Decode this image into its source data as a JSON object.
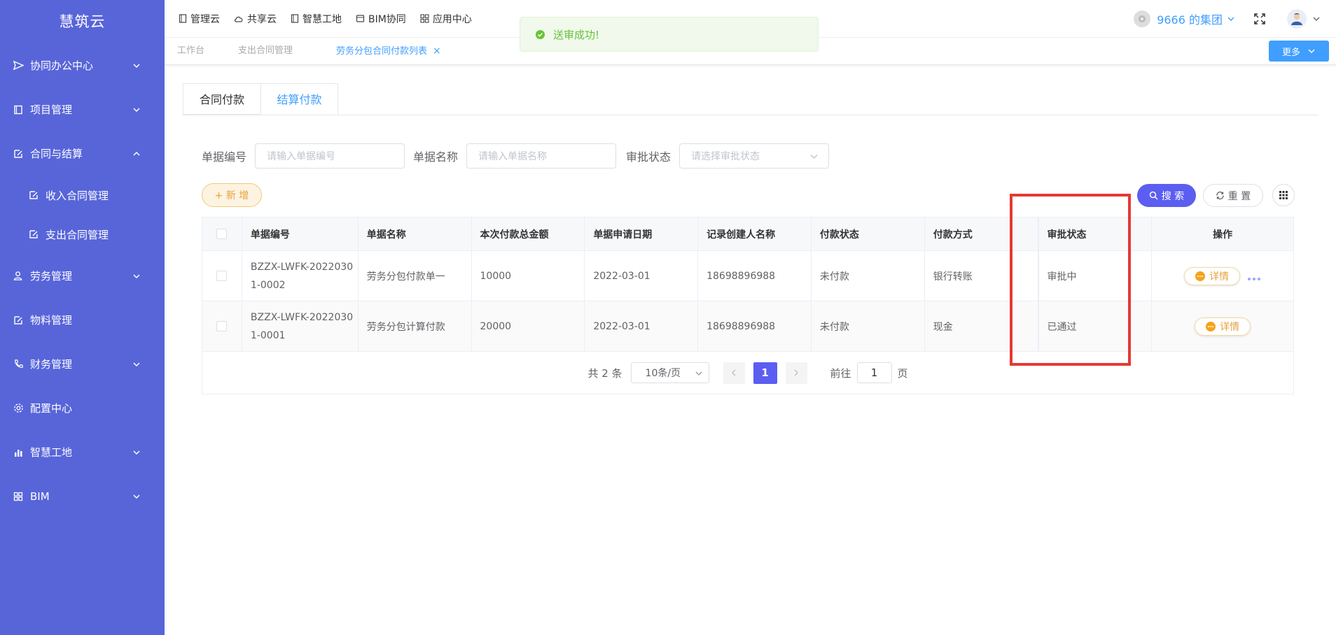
{
  "brand": "慧筑云",
  "sidebar": {
    "items": [
      {
        "label": "协同办公中心",
        "icon": "send-icon"
      },
      {
        "label": "项目管理",
        "icon": "book-icon"
      },
      {
        "label": "合同与结算",
        "icon": "edit-doc-icon"
      },
      {
        "label": "收入合同管理",
        "icon": "edit-doc-icon"
      },
      {
        "label": "支出合同管理",
        "icon": "edit-doc-icon"
      },
      {
        "label": "劳务管理",
        "icon": "user-group-icon"
      },
      {
        "label": "物料管理",
        "icon": "edit-doc-icon"
      },
      {
        "label": "财务管理",
        "icon": "phone-icon"
      },
      {
        "label": "配置中心",
        "icon": "gear-icon"
      },
      {
        "label": "智慧工地",
        "icon": "bar-chart-icon"
      },
      {
        "label": "BIM",
        "icon": "grid-icon"
      }
    ]
  },
  "topnav": {
    "items": [
      {
        "label": "管理云",
        "icon": "book-icon"
      },
      {
        "label": "共享云",
        "icon": "cloud-icon"
      },
      {
        "label": "智慧工地",
        "icon": "book-icon"
      },
      {
        "label": "BIM协同",
        "icon": "cube-icon"
      },
      {
        "label": "应用中心",
        "icon": "grid-icon"
      }
    ],
    "org_name": "9666 的集团"
  },
  "tabs": {
    "items": [
      {
        "label": "工作台"
      },
      {
        "label": "支出合同管理"
      },
      {
        "label": "劳务分包合同付款列表"
      }
    ],
    "close_glyph": "×",
    "more_label": "更多"
  },
  "toast": {
    "message": "送审成功!"
  },
  "subtabs": [
    "合同付款",
    "结算付款"
  ],
  "filters": {
    "code_label": "单据编号",
    "code_placeholder": "请输入单据编号",
    "name_label": "单据名称",
    "name_placeholder": "请输入单据名称",
    "status_label": "审批状态",
    "status_placeholder": "请选择审批状态"
  },
  "toolbar": {
    "add_label": "+ 新 增",
    "search_label": "搜 索",
    "reset_label": "重 置"
  },
  "table": {
    "headers": [
      "单据编号",
      "单据名称",
      "本次付款总金额",
      "单据申请日期",
      "记录创建人名称",
      "付款状态",
      "付款方式",
      "审批状态",
      "操作"
    ],
    "rows": [
      {
        "code_line1": "BZZX-LWFK-2022030",
        "code_line2": "1-0002",
        "name": "劳务分包付款单一",
        "amount": "10000",
        "date": "2022-03-01",
        "creator": "18698896988",
        "pay_status": "未付款",
        "pay_method": "银行转账",
        "approval": "审批中",
        "action": "详情"
      },
      {
        "code_line1": "BZZX-LWFK-2022030",
        "code_line2": "1-0001",
        "name": "劳务分包计算付款",
        "amount": "20000",
        "date": "2022-03-01",
        "creator": "18698896988",
        "pay_status": "未付款",
        "pay_method": "现金",
        "approval": "已通过",
        "action": "详情"
      }
    ]
  },
  "pager": {
    "total": "共 2 条",
    "page_size": "10条/页",
    "current": "1",
    "goto_prefix": "前往",
    "goto_value": "1",
    "goto_suffix": "页"
  }
}
